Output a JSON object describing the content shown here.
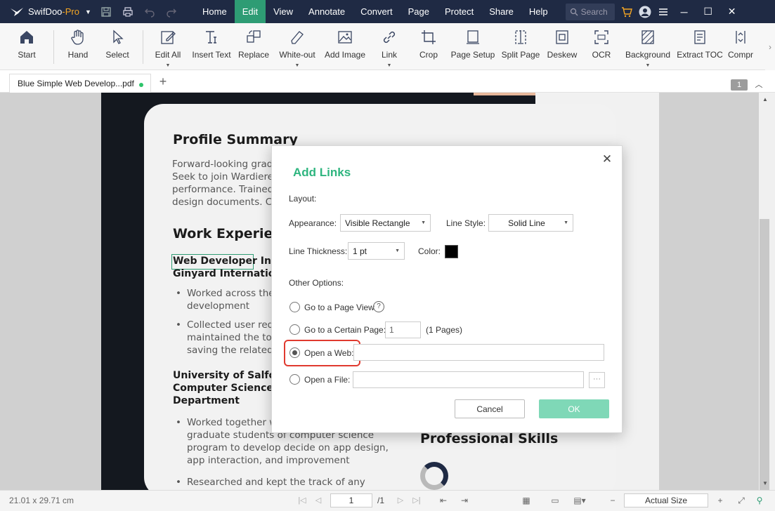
{
  "app": {
    "name": "SwifDoo",
    "name_suffix": "-Pro"
  },
  "menu": [
    "Home",
    "Edit",
    "View",
    "Annotate",
    "Convert",
    "Page",
    "Protect",
    "Share",
    "Help"
  ],
  "search": {
    "placeholder": "Search"
  },
  "ribbon": {
    "start": "Start",
    "hand": "Hand",
    "select": "Select",
    "edit_all": "Edit All",
    "insert_text": "Insert Text",
    "replace": "Replace",
    "white_out": "White-out",
    "add_image": "Add Image",
    "link": "Link",
    "crop": "Crop",
    "page_setup": "Page Setup",
    "split_page": "Split Page",
    "deskew": "Deskew",
    "ocr": "OCR",
    "background": "Background",
    "extract_toc": "Extract TOC",
    "compress": "Compr"
  },
  "tabs": {
    "doc_tab": "Blue Simple Web Develop...pdf",
    "page_badge": "1"
  },
  "document": {
    "profile_heading": "Profile Summary",
    "profile_lines": [
      "Forward-looking grad",
      "Seek to join Wardiere",
      "performance. Trained",
      "design documents. Co"
    ],
    "work_heading": "Work Experie",
    "job_title": "Web Developer",
    "job_title_rest": " Int",
    "company": "Ginyard Internation",
    "bullet1": [
      "Worked across the",
      "development"
    ],
    "bullet2": [
      "Collected user requ",
      "maintained the too",
      "saving the related"
    ],
    "edu_lines": [
      "University of Salfor",
      "Computer Science",
      "Department"
    ],
    "bullet3": [
      "Worked together w",
      "graduate students of computer science",
      "program to develop decide on app design,",
      "app interaction, and improvement"
    ],
    "bullet4": [
      "Researched and kept the track of any"
    ],
    "skills_heading": "Professional Skills"
  },
  "dialog": {
    "title": "Add Links",
    "layout_label": "Layout:",
    "appearance_label": "Appearance:",
    "appearance_value": "Visible Rectangle",
    "line_style_label": "Line Style:",
    "line_style_value": "Solid Line",
    "line_thickness_label": "Line Thickness:",
    "line_thickness_value": "1 pt",
    "color_label": "Color:",
    "color_value": "#000000",
    "other_options_label": "Other Options:",
    "opt_page_view": "Go to a Page View",
    "opt_certain_page": "Go to a Certain Page:",
    "certain_page_value": "1",
    "pages_note": "(1 Pages)",
    "opt_web": "Open a Web:",
    "web_value": "",
    "opt_file": "Open a File:",
    "file_value": "",
    "browse_label": "···",
    "cancel": "Cancel",
    "ok": "OK"
  },
  "status": {
    "dimensions": "21.01 x 29.71 cm",
    "page_input": "1",
    "page_total": "/1",
    "zoom": "Actual Size"
  },
  "colors": {
    "titlebar": "#1f2a44",
    "accent": "#2e9c74",
    "dialog_title": "#2eb57f",
    "highlight": "#e03a2f"
  }
}
